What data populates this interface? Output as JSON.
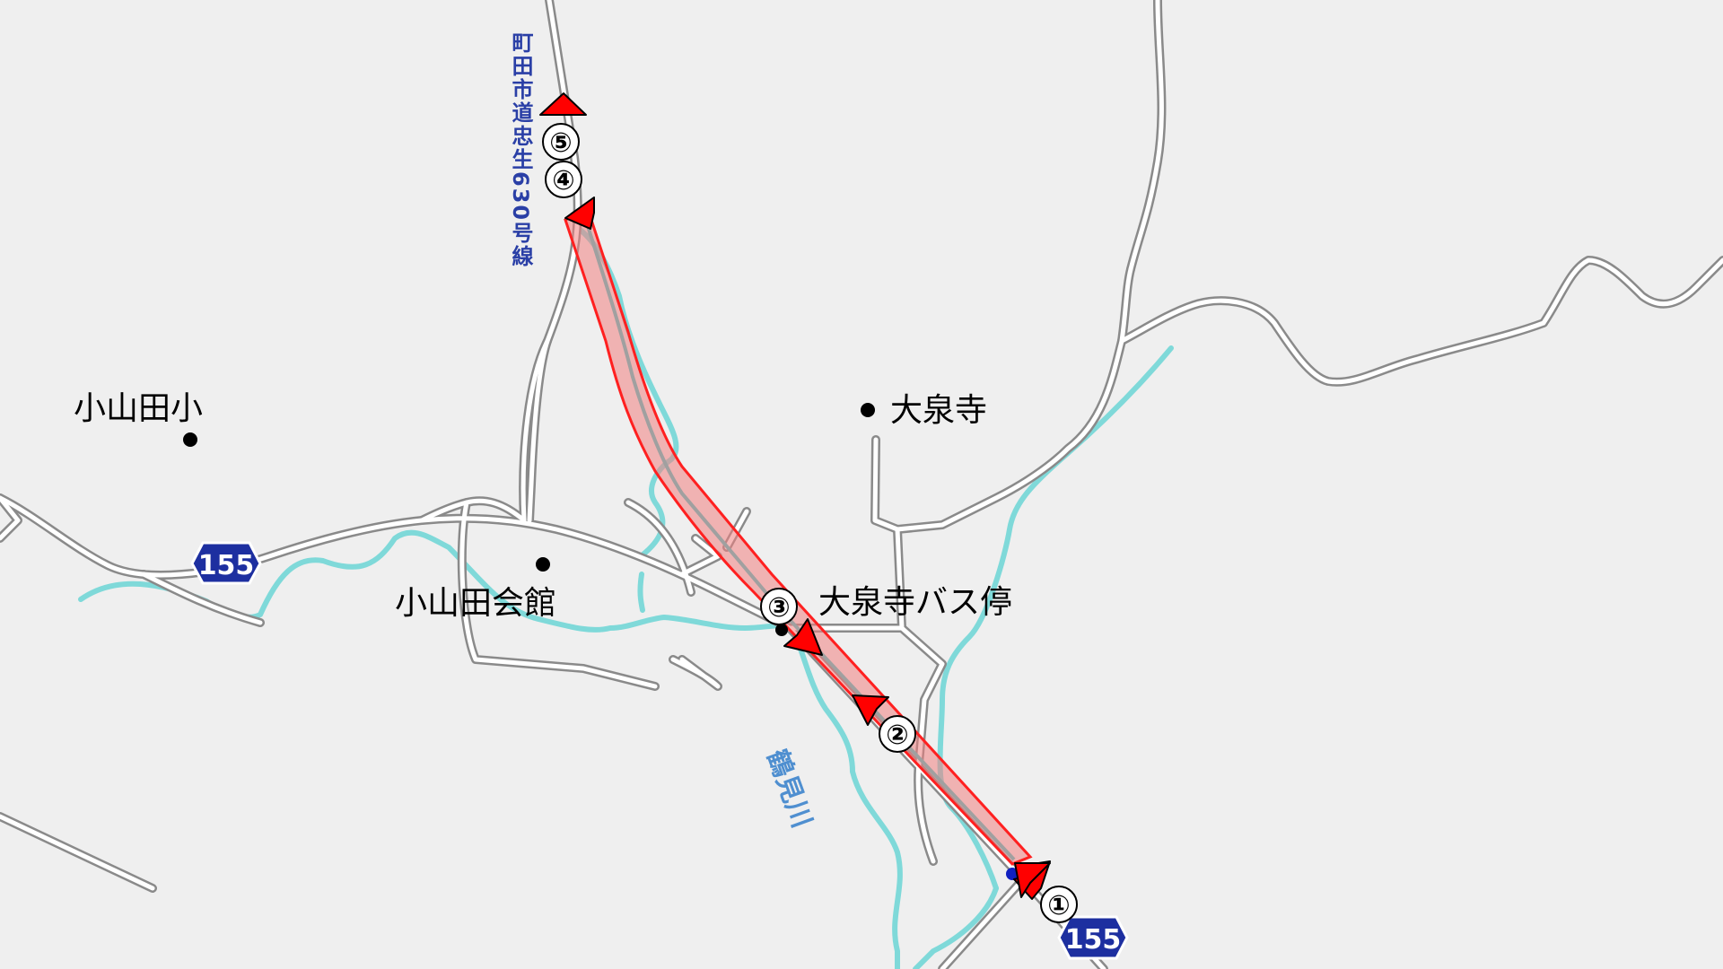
{
  "map": {
    "places": [
      {
        "id": "oyamada-elementary",
        "label": "小山田小"
      },
      {
        "id": "daisenji-temple",
        "label": "大泉寺"
      },
      {
        "id": "oyamada-hall",
        "label": "小山田会館"
      },
      {
        "id": "daisenji-bus-stop",
        "label": "大泉寺バス停"
      }
    ],
    "road_name_vertical": "町田市道忠生630号線",
    "river_name": "鶴見川",
    "route_shields": [
      "155",
      "155"
    ],
    "route_steps": [
      "①",
      "②",
      "③",
      "④",
      "⑤"
    ],
    "colors": {
      "background": "#efefef",
      "road_fill": "#ffffff",
      "road_casing": "#8a8a8a",
      "river": "#7fd9d9",
      "route_highlight": "#f08080",
      "arrow": "#ff0000",
      "shield": "#1d2fa0",
      "road_label": "#2a3fa6",
      "river_label": "#4f8fd0"
    }
  }
}
